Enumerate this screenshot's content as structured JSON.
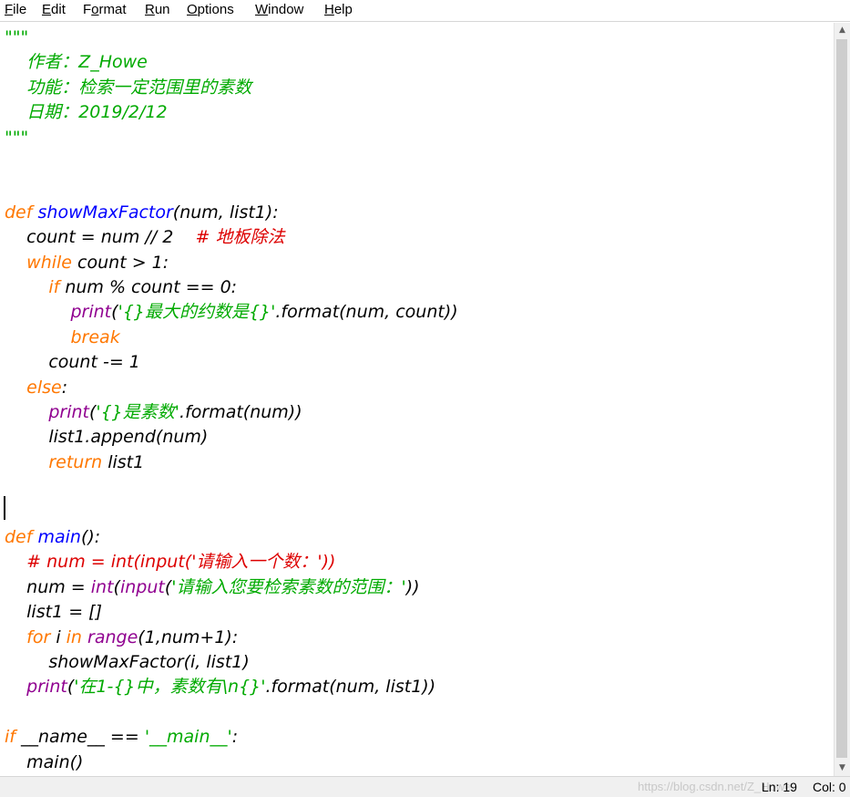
{
  "menu": [
    {
      "label": "File",
      "mnemonic": "F",
      "rest": "ile"
    },
    {
      "label": "Edit",
      "mnemonic": "E",
      "rest": "dit"
    },
    {
      "label": "Format",
      "mnemonic": "o",
      "pre": "F",
      "rest": "rmat"
    },
    {
      "label": "Run",
      "mnemonic": "R",
      "rest": "un"
    },
    {
      "label": "Options",
      "mnemonic": "O",
      "rest": "ptions"
    },
    {
      "label": "Window",
      "mnemonic": "W",
      "rest": "indow"
    },
    {
      "label": "Help",
      "mnemonic": "H",
      "rest": "elp"
    }
  ],
  "code_lines": [
    [
      [
        "\"\"\"",
        "string"
      ]
    ],
    [
      [
        "    作者：",
        "string"
      ],
      [
        "Z_Howe",
        "string"
      ]
    ],
    [
      [
        "    功能：检索一定范围里的素数",
        "string"
      ]
    ],
    [
      [
        "    日期：",
        "string"
      ],
      [
        "2019/2/12",
        "string"
      ]
    ],
    [
      [
        "\"\"\"",
        "string"
      ]
    ],
    [],
    [],
    [
      [
        "def",
        "keyword"
      ],
      [
        " ",
        "default"
      ],
      [
        "showMaxFactor",
        "def"
      ],
      [
        "(num, list1):",
        "default"
      ]
    ],
    [
      [
        "    count = num // 2    ",
        "default"
      ],
      [
        "# 地板除法",
        "comment"
      ]
    ],
    [
      [
        "    ",
        "default"
      ],
      [
        "while",
        "keyword"
      ],
      [
        " count > 1:",
        "default"
      ]
    ],
    [
      [
        "        ",
        "default"
      ],
      [
        "if",
        "keyword"
      ],
      [
        " num % count == 0:",
        "default"
      ]
    ],
    [
      [
        "            ",
        "default"
      ],
      [
        "print",
        "builtin"
      ],
      [
        "(",
        "default"
      ],
      [
        "'{}最大的约数是{}'",
        "string"
      ],
      [
        ".format(num, count))",
        "default"
      ]
    ],
    [
      [
        "            ",
        "default"
      ],
      [
        "break",
        "keyword"
      ]
    ],
    [
      [
        "        count -= 1",
        "default"
      ]
    ],
    [
      [
        "    ",
        "default"
      ],
      [
        "else",
        "keyword"
      ],
      [
        ":",
        "default"
      ]
    ],
    [
      [
        "        ",
        "default"
      ],
      [
        "print",
        "builtin"
      ],
      [
        "(",
        "default"
      ],
      [
        "'{}是素数'",
        "string"
      ],
      [
        ".format(num))",
        "default"
      ]
    ],
    [
      [
        "        list1.append(num)",
        "default"
      ]
    ],
    [
      [
        "        ",
        "default"
      ],
      [
        "return",
        "keyword"
      ],
      [
        " list1",
        "default"
      ]
    ],
    [],
    [],
    [
      [
        "def",
        "keyword"
      ],
      [
        " ",
        "default"
      ],
      [
        "main",
        "def"
      ],
      [
        "():",
        "default"
      ]
    ],
    [
      [
        "    ",
        "default"
      ],
      [
        "# num = int(input('请输入一个数：'))",
        "comment"
      ]
    ],
    [
      [
        "    num = ",
        "default"
      ],
      [
        "int",
        "builtin"
      ],
      [
        "(",
        "default"
      ],
      [
        "input",
        "builtin"
      ],
      [
        "(",
        "default"
      ],
      [
        "'请输入您要检索素数的范围：'",
        "string"
      ],
      [
        "))",
        "default"
      ]
    ],
    [
      [
        "    list1 = []",
        "default"
      ]
    ],
    [
      [
        "    ",
        "default"
      ],
      [
        "for",
        "keyword"
      ],
      [
        " i ",
        "default"
      ],
      [
        "in",
        "keyword"
      ],
      [
        " ",
        "default"
      ],
      [
        "range",
        "builtin"
      ],
      [
        "(1,num+1):",
        "default"
      ]
    ],
    [
      [
        "        showMaxFactor(i, list1)",
        "default"
      ]
    ],
    [
      [
        "    ",
        "default"
      ],
      [
        "print",
        "builtin"
      ],
      [
        "(",
        "default"
      ],
      [
        "'在1-{}中，素数有\\n{}'",
        "string"
      ],
      [
        ".format(num, list1))",
        "default"
      ]
    ],
    [],
    [
      [
        "if",
        "keyword"
      ],
      [
        " __name__ == ",
        "default"
      ],
      [
        "'__main__'",
        "string"
      ],
      [
        ":",
        "default"
      ]
    ],
    [
      [
        "    main()",
        "default"
      ]
    ]
  ],
  "status": {
    "line": "Ln: 19",
    "col": "Col: 0",
    "watermark": "https://blog.csdn.net/Z_Howe"
  },
  "icons": {
    "scroll_up": "▲",
    "scroll_down": "▼"
  }
}
